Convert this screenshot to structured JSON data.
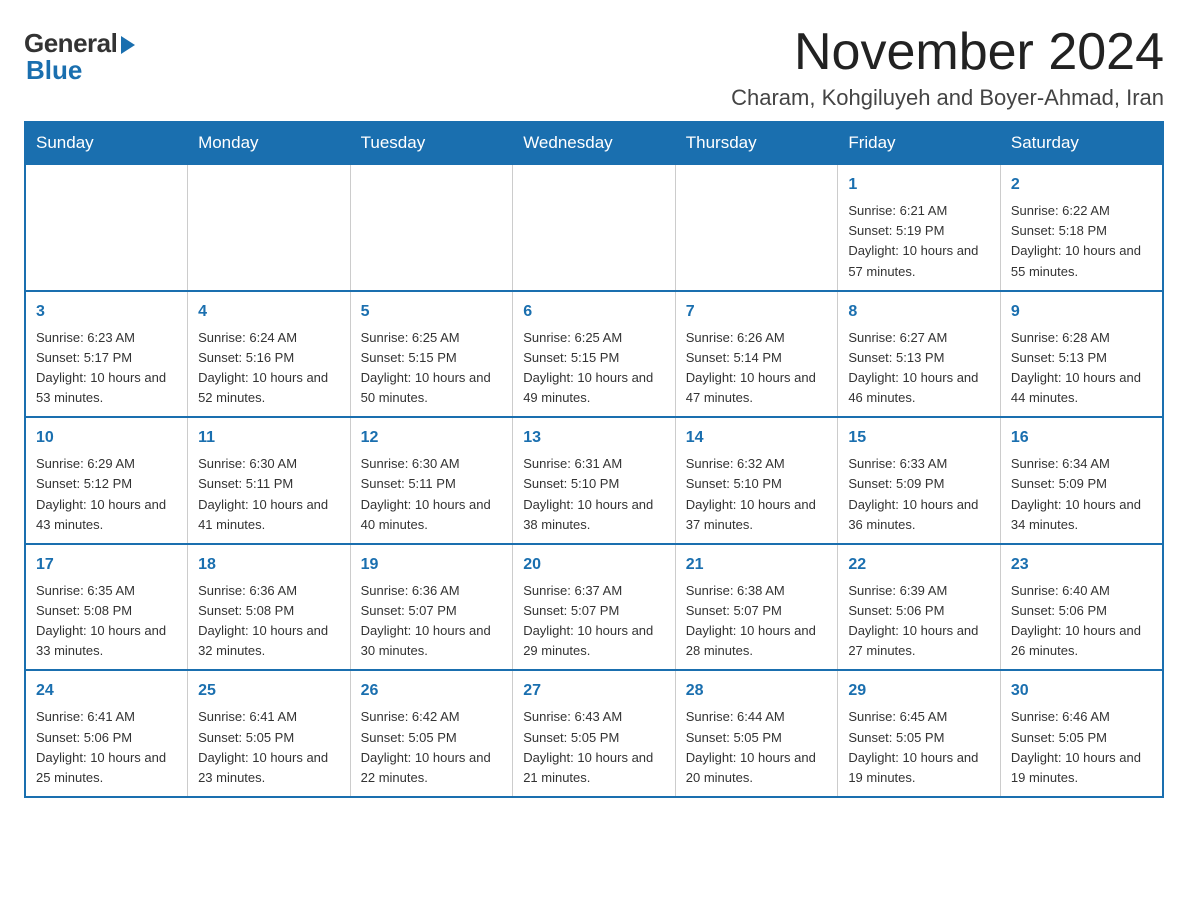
{
  "logo": {
    "general": "General",
    "blue": "Blue"
  },
  "title": "November 2024",
  "subtitle": "Charam, Kohgiluyeh and Boyer-Ahmad, Iran",
  "days_of_week": [
    "Sunday",
    "Monday",
    "Tuesday",
    "Wednesday",
    "Thursday",
    "Friday",
    "Saturday"
  ],
  "weeks": [
    {
      "days": [
        {
          "num": "",
          "info": ""
        },
        {
          "num": "",
          "info": ""
        },
        {
          "num": "",
          "info": ""
        },
        {
          "num": "",
          "info": ""
        },
        {
          "num": "",
          "info": ""
        },
        {
          "num": "1",
          "info": "Sunrise: 6:21 AM\nSunset: 5:19 PM\nDaylight: 10 hours and 57 minutes."
        },
        {
          "num": "2",
          "info": "Sunrise: 6:22 AM\nSunset: 5:18 PM\nDaylight: 10 hours and 55 minutes."
        }
      ]
    },
    {
      "days": [
        {
          "num": "3",
          "info": "Sunrise: 6:23 AM\nSunset: 5:17 PM\nDaylight: 10 hours and 53 minutes."
        },
        {
          "num": "4",
          "info": "Sunrise: 6:24 AM\nSunset: 5:16 PM\nDaylight: 10 hours and 52 minutes."
        },
        {
          "num": "5",
          "info": "Sunrise: 6:25 AM\nSunset: 5:15 PM\nDaylight: 10 hours and 50 minutes."
        },
        {
          "num": "6",
          "info": "Sunrise: 6:25 AM\nSunset: 5:15 PM\nDaylight: 10 hours and 49 minutes."
        },
        {
          "num": "7",
          "info": "Sunrise: 6:26 AM\nSunset: 5:14 PM\nDaylight: 10 hours and 47 minutes."
        },
        {
          "num": "8",
          "info": "Sunrise: 6:27 AM\nSunset: 5:13 PM\nDaylight: 10 hours and 46 minutes."
        },
        {
          "num": "9",
          "info": "Sunrise: 6:28 AM\nSunset: 5:13 PM\nDaylight: 10 hours and 44 minutes."
        }
      ]
    },
    {
      "days": [
        {
          "num": "10",
          "info": "Sunrise: 6:29 AM\nSunset: 5:12 PM\nDaylight: 10 hours and 43 minutes."
        },
        {
          "num": "11",
          "info": "Sunrise: 6:30 AM\nSunset: 5:11 PM\nDaylight: 10 hours and 41 minutes."
        },
        {
          "num": "12",
          "info": "Sunrise: 6:30 AM\nSunset: 5:11 PM\nDaylight: 10 hours and 40 minutes."
        },
        {
          "num": "13",
          "info": "Sunrise: 6:31 AM\nSunset: 5:10 PM\nDaylight: 10 hours and 38 minutes."
        },
        {
          "num": "14",
          "info": "Sunrise: 6:32 AM\nSunset: 5:10 PM\nDaylight: 10 hours and 37 minutes."
        },
        {
          "num": "15",
          "info": "Sunrise: 6:33 AM\nSunset: 5:09 PM\nDaylight: 10 hours and 36 minutes."
        },
        {
          "num": "16",
          "info": "Sunrise: 6:34 AM\nSunset: 5:09 PM\nDaylight: 10 hours and 34 minutes."
        }
      ]
    },
    {
      "days": [
        {
          "num": "17",
          "info": "Sunrise: 6:35 AM\nSunset: 5:08 PM\nDaylight: 10 hours and 33 minutes."
        },
        {
          "num": "18",
          "info": "Sunrise: 6:36 AM\nSunset: 5:08 PM\nDaylight: 10 hours and 32 minutes."
        },
        {
          "num": "19",
          "info": "Sunrise: 6:36 AM\nSunset: 5:07 PM\nDaylight: 10 hours and 30 minutes."
        },
        {
          "num": "20",
          "info": "Sunrise: 6:37 AM\nSunset: 5:07 PM\nDaylight: 10 hours and 29 minutes."
        },
        {
          "num": "21",
          "info": "Sunrise: 6:38 AM\nSunset: 5:07 PM\nDaylight: 10 hours and 28 minutes."
        },
        {
          "num": "22",
          "info": "Sunrise: 6:39 AM\nSunset: 5:06 PM\nDaylight: 10 hours and 27 minutes."
        },
        {
          "num": "23",
          "info": "Sunrise: 6:40 AM\nSunset: 5:06 PM\nDaylight: 10 hours and 26 minutes."
        }
      ]
    },
    {
      "days": [
        {
          "num": "24",
          "info": "Sunrise: 6:41 AM\nSunset: 5:06 PM\nDaylight: 10 hours and 25 minutes."
        },
        {
          "num": "25",
          "info": "Sunrise: 6:41 AM\nSunset: 5:05 PM\nDaylight: 10 hours and 23 minutes."
        },
        {
          "num": "26",
          "info": "Sunrise: 6:42 AM\nSunset: 5:05 PM\nDaylight: 10 hours and 22 minutes."
        },
        {
          "num": "27",
          "info": "Sunrise: 6:43 AM\nSunset: 5:05 PM\nDaylight: 10 hours and 21 minutes."
        },
        {
          "num": "28",
          "info": "Sunrise: 6:44 AM\nSunset: 5:05 PM\nDaylight: 10 hours and 20 minutes."
        },
        {
          "num": "29",
          "info": "Sunrise: 6:45 AM\nSunset: 5:05 PM\nDaylight: 10 hours and 19 minutes."
        },
        {
          "num": "30",
          "info": "Sunrise: 6:46 AM\nSunset: 5:05 PM\nDaylight: 10 hours and 19 minutes."
        }
      ]
    }
  ]
}
